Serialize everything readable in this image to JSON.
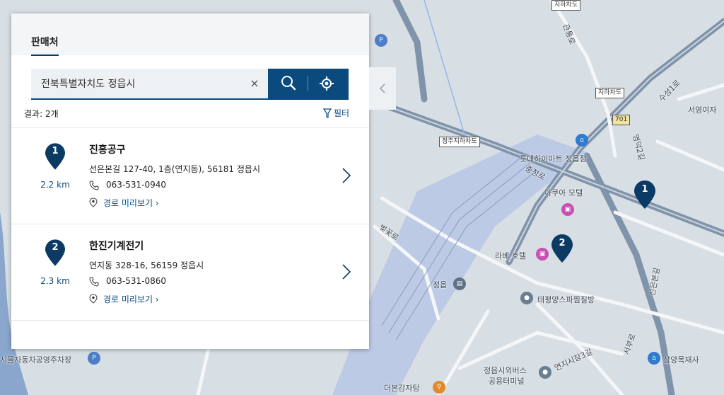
{
  "panel": {
    "tab_label": "판매처",
    "search": {
      "value": "전북특별자치도 정읍시",
      "clear_symbol": "×"
    },
    "result_count": "결과: 2개",
    "filter_label": "필터",
    "results": [
      {
        "number": "1",
        "distance": "2.2 km",
        "name": "진흥공구",
        "address": "선은본길 127-40, 1층(연지동), 56181 정읍시",
        "phone": "063-531-0940",
        "route_label": "경로 미리보기"
      },
      {
        "number": "2",
        "distance": "2.3 km",
        "name": "한진기계전기",
        "address": "연지동 328-16, 56159 정읍시",
        "phone": "063-531-0860",
        "route_label": "경로 미리보기"
      }
    ]
  },
  "map": {
    "labels": {
      "lotte": "롯데하이마트 정읍점",
      "akuai": "아쿠아 모텔",
      "rabe": "라베 호텔",
      "jeongeup": "정읍",
      "taepyeong": "태평양스파찜질방",
      "terminal1": "정읍시외버스",
      "terminal2": "공용터미널",
      "deobon": "더본감자탕",
      "samyang": "삼양목재사",
      "seoyeong": "서영여자",
      "parking": "시물자동차공영주차장",
      "road_chungjeong": "충정로",
      "road_yeongdeok": "영덕2길",
      "road_suseong": "수성1로",
      "road_seoksa": "서부로",
      "road_bitgot": "벚꽃로",
      "road_yeonji": "연지시장3길",
      "road_seoeunbon": "선은본길",
      "road_gwanbong": "관통로"
    },
    "boxes": {
      "underpass1": "지하차도",
      "underpass2": "지하차도",
      "underpass3": "정주지하차도",
      "route": "701"
    },
    "pins": [
      "1",
      "2"
    ],
    "colors": {
      "accent": "#0b4a7d",
      "pin": "#0b3a63",
      "road": "#7a90a8",
      "rail": "#a9bbe0"
    }
  }
}
